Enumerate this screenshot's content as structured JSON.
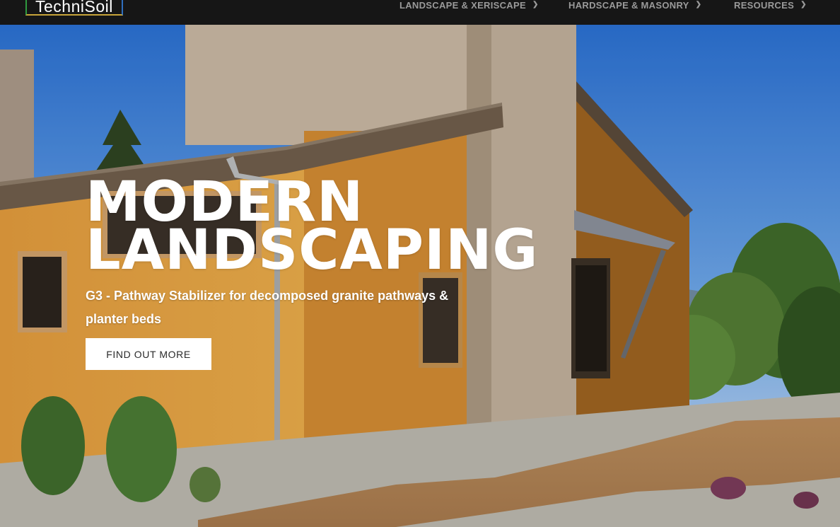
{
  "brand": {
    "logo_text": "TechniSoil"
  },
  "nav": {
    "items": [
      {
        "label": "LANDSCAPE & XERISCAPE"
      },
      {
        "label": "HARDSCAPE & MASONRY"
      },
      {
        "label": "RESOURCES"
      }
    ]
  },
  "hero": {
    "headline_line1": "MODERN",
    "headline_line2": "LANDSCAPING",
    "subtitle": "G3 - Pathway Stabilizer for decomposed granite pathways & planter beds",
    "cta_label": "FIND OUT MORE"
  },
  "colors": {
    "header_bg": "#161616",
    "cta_bg": "#ffffff",
    "headline": "#ffffff"
  },
  "icons": [
    "chevron-down-icon"
  ]
}
